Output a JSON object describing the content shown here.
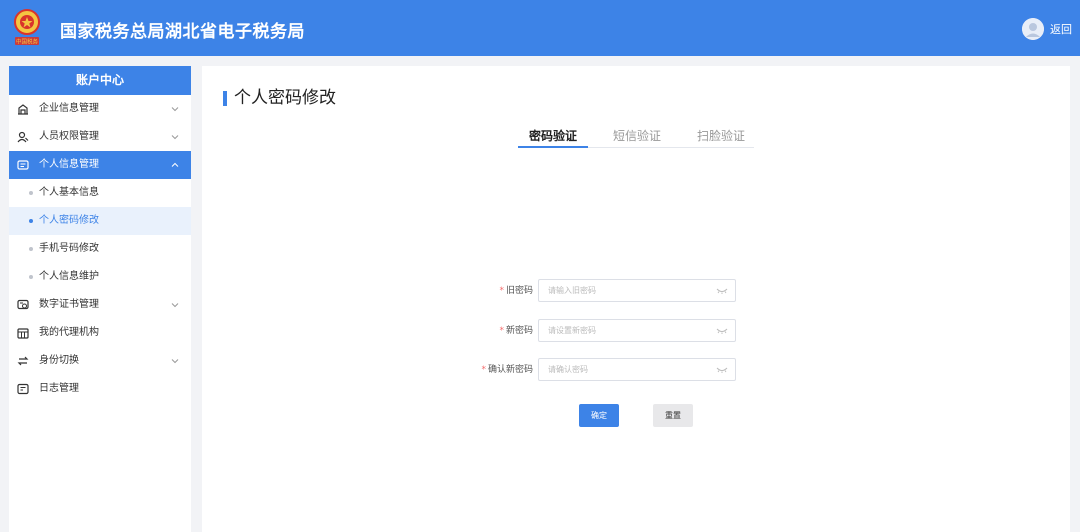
{
  "app": {
    "title": "国家税务总局湖北省电子税务局",
    "back_label": "返回",
    "emblem_text": "中国税务"
  },
  "colors": {
    "primary": "#3d83e7",
    "page_bg": "#f2f3f6",
    "required": "#f56c6c"
  },
  "sidebar": {
    "header": "账户中心",
    "items": [
      {
        "label": "企业信息管理",
        "icon": "building-icon",
        "expandable": true
      },
      {
        "label": "人员权限管理",
        "icon": "user-permission-icon",
        "expandable": true
      },
      {
        "label": "个人信息管理",
        "icon": "profile-card-icon",
        "expandable": true,
        "expanded": true
      },
      {
        "label": "数字证书管理",
        "icon": "certificate-icon",
        "expandable": true
      },
      {
        "label": "我的代理机构",
        "icon": "agency-icon",
        "expandable": false
      },
      {
        "label": "身份切换",
        "icon": "switch-icon",
        "expandable": true
      },
      {
        "label": "日志管理",
        "icon": "log-icon",
        "expandable": false
      }
    ],
    "subitems": [
      {
        "label": "个人基本信息"
      },
      {
        "label": "个人密码修改",
        "selected": true
      },
      {
        "label": "手机号码修改"
      },
      {
        "label": "个人信息维护"
      }
    ]
  },
  "main": {
    "title": "个人密码修改",
    "tabs": [
      {
        "label": "密码验证",
        "active": true
      },
      {
        "label": "短信验证",
        "active": false
      },
      {
        "label": "扫脸验证",
        "active": false
      }
    ],
    "form": {
      "fields": [
        {
          "label": "旧密码",
          "placeholder": "请输入旧密码",
          "value": ""
        },
        {
          "label": "新密码",
          "placeholder": "请设置新密码",
          "value": ""
        },
        {
          "label": "确认新密码",
          "placeholder": "请确认密码",
          "value": ""
        }
      ],
      "confirm_label": "确定",
      "reset_label": "重置"
    }
  }
}
